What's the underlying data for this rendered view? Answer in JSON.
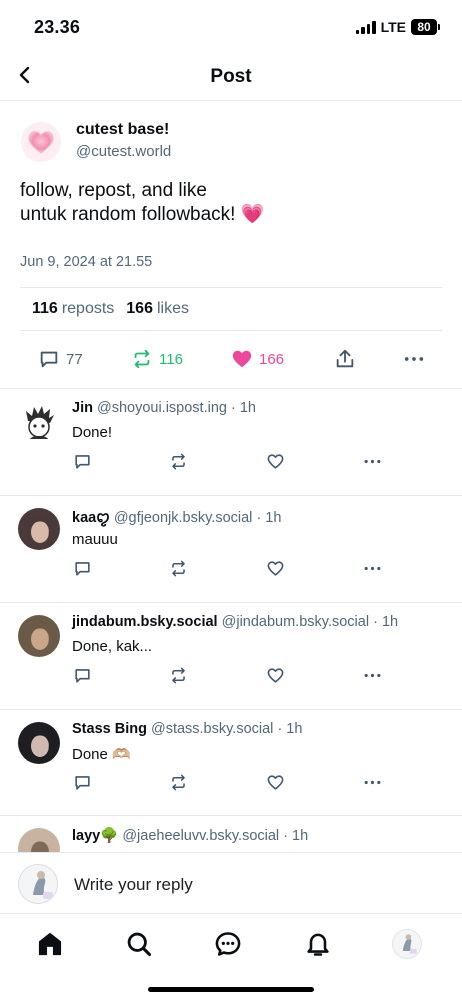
{
  "status_bar": {
    "time": "23.36",
    "network": "LTE",
    "battery": "80"
  },
  "header": {
    "title": "Post"
  },
  "post": {
    "author_name": "cutest base!",
    "author_handle": "@cutest.world",
    "text_line1": "follow, repost, and like",
    "text_line2": "untuk random followback! 💗",
    "date": "Jun 9, 2024 at 21.55",
    "reposts_count": "116",
    "reposts_label": "reposts",
    "likes_count": "166",
    "likes_label": "likes",
    "reply_count": "77",
    "repost_count": "116",
    "like_count": "166"
  },
  "replies": [
    {
      "name": "Jin",
      "handle": "@shoyoui.ispost.ing",
      "time": "· 1h",
      "text": "Done!"
    },
    {
      "name": "kaaꨄ︎",
      "handle": "@gfjeonjk.bsky.social",
      "time": "· 1h",
      "text": "mauuu"
    },
    {
      "name": "jindabum.bsky.social",
      "handle": "@jindabum.bsky.social",
      "time": "· 1h",
      "text": "Done, kak..."
    },
    {
      "name": "Stass Bing",
      "handle": "@stass.bsky.social",
      "time": "· 1h",
      "text": "Done 🫶🏼"
    },
    {
      "name": "layy🌳",
      "handle": "@jaeheeluvv.bsky.social",
      "time": "· 1h",
      "text": ""
    }
  ],
  "compose": {
    "placeholder": "Write your reply"
  },
  "colors": {
    "accent_green": "#20bc6f",
    "accent_pink": "#ec4899",
    "muted": "#52687a",
    "icon_blue": "#42576c"
  },
  "icons": [
    "back-arrow-icon",
    "comment-icon",
    "repost-icon",
    "heart-icon",
    "share-icon",
    "more-icon",
    "home-icon",
    "search-icon",
    "chat-icon",
    "bell-icon"
  ]
}
